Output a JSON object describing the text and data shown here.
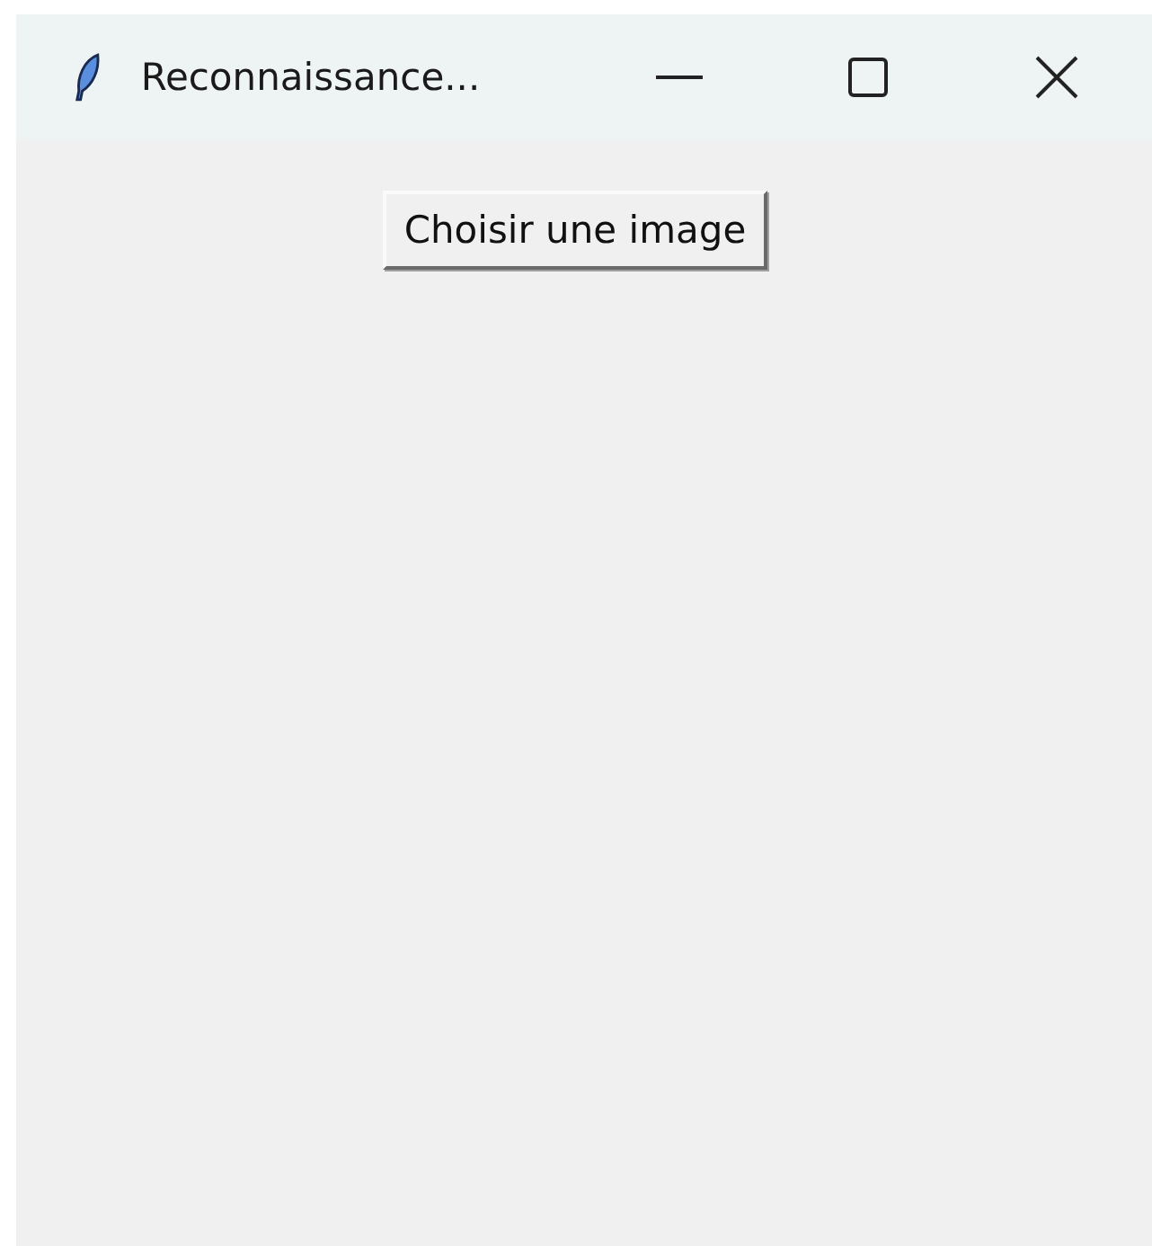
{
  "window": {
    "title": "Reconnaissance..."
  },
  "button": {
    "label": "Choisir une image"
  }
}
